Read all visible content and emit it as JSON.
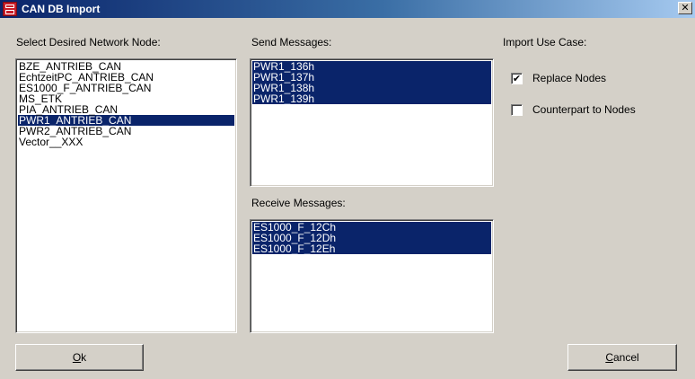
{
  "window": {
    "title": "CAN DB Import",
    "close_glyph": "✕"
  },
  "node_panel": {
    "label": "Select Desired Network Node:",
    "items": [
      {
        "text": "BZE_ANTRIEB_CAN",
        "selected": false
      },
      {
        "text": "EchtzeitPC_ANTRIEB_CAN",
        "selected": false
      },
      {
        "text": "ES1000_F_ANTRIEB_CAN",
        "selected": false
      },
      {
        "text": "MS_ETK",
        "selected": false
      },
      {
        "text": "PIA_ANTRIEB_CAN",
        "selected": false
      },
      {
        "text": "PWR1_ANTRIEB_CAN",
        "selected": true
      },
      {
        "text": "PWR2_ANTRIEB_CAN",
        "selected": false
      },
      {
        "text": "Vector__XXX",
        "selected": false
      }
    ]
  },
  "send_panel": {
    "label": "Send Messages:",
    "items": [
      {
        "text": "PWR1_136h",
        "selected": true
      },
      {
        "text": "PWR1_137h",
        "selected": true
      },
      {
        "text": "PWR1_138h",
        "selected": true
      },
      {
        "text": "PWR1_139h",
        "selected": true
      }
    ]
  },
  "receive_panel": {
    "label": "Receive Messages:",
    "items": [
      {
        "text": "ES1000_F_12Ch",
        "selected": true
      },
      {
        "text": "ES1000_F_12Dh",
        "selected": true
      },
      {
        "text": "ES1000_F_12Eh",
        "selected": true
      }
    ]
  },
  "use_case": {
    "label": "Import Use Case:",
    "replace_nodes": {
      "label": "Replace Nodes",
      "checked": true,
      "check_glyph": "✔"
    },
    "counterpart_nodes": {
      "label": "Counterpart to Nodes",
      "checked": false
    }
  },
  "buttons": {
    "ok": {
      "mnemonic": "O",
      "rest": "k"
    },
    "cancel": {
      "mnemonic": "C",
      "rest": "ancel"
    }
  },
  "colors": {
    "selection_bg": "#0a246a",
    "dialog_bg": "#d4d0c8"
  }
}
